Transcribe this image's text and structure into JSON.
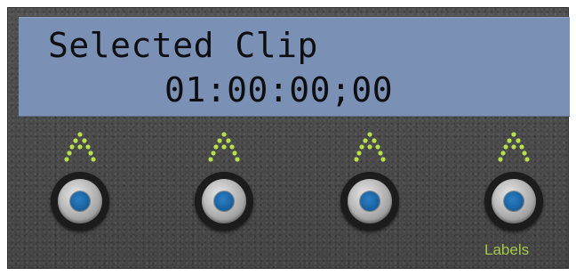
{
  "display": {
    "line1": "Selected Clip",
    "line2": "01:00:00;00"
  },
  "buttons": [
    {
      "id": "btn-1",
      "indicator_icon": "up-arrow-led-icon"
    },
    {
      "id": "btn-2",
      "indicator_icon": "up-arrow-led-icon"
    },
    {
      "id": "btn-3",
      "indicator_icon": "up-arrow-led-icon"
    },
    {
      "id": "btn-4",
      "indicator_icon": "up-arrow-led-icon",
      "caption": "Labels"
    }
  ],
  "colors": {
    "lcd_background": "#7a90b5",
    "led_green": "#b8e04a",
    "label_green": "#a6c84a",
    "knob_blue": "#1a6aad"
  }
}
